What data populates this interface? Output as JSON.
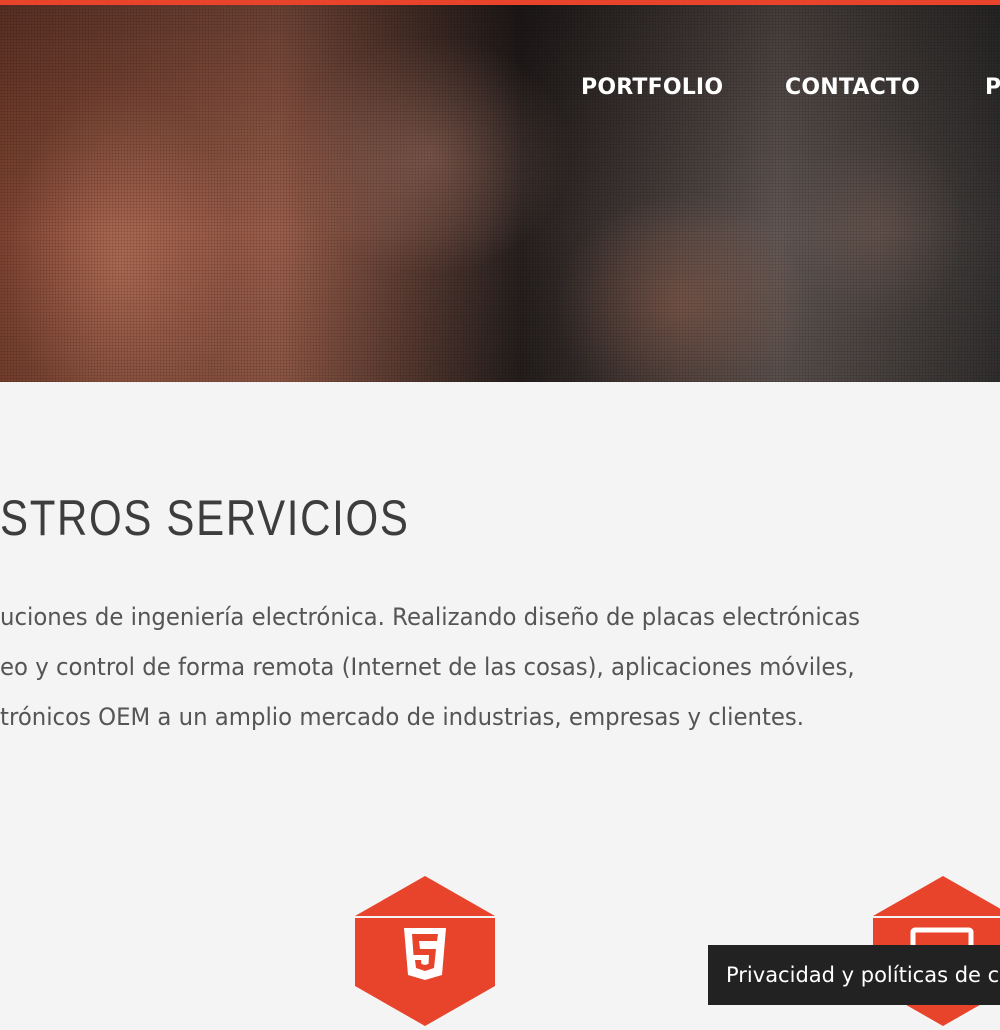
{
  "nav": {
    "items": [
      {
        "label": "PORTFOLIO"
      },
      {
        "label": "CONTACTO"
      },
      {
        "label": "P"
      }
    ]
  },
  "services": {
    "title": "STROS SERVICIOS",
    "description_lines": [
      "uciones de ingeniería electrónica. Realizando diseño de placas electrónicas",
      "eo y control de forma remota (Internet de las cosas), aplicaciones móviles,",
      "trónicos OEM a un amplio mercado de industrias, empresas y clientes."
    ],
    "cards": [
      {
        "icon": "html5-icon"
      },
      {
        "icon": "monitor-icon"
      }
    ]
  },
  "cookie_notice": {
    "text": "Privacidad y políticas de c"
  },
  "colors": {
    "accent": "#e8432b",
    "title_text": "#3d3d3d",
    "body_text": "#555555",
    "background": "#f4f4f4",
    "cookie_bar": "#222222"
  }
}
